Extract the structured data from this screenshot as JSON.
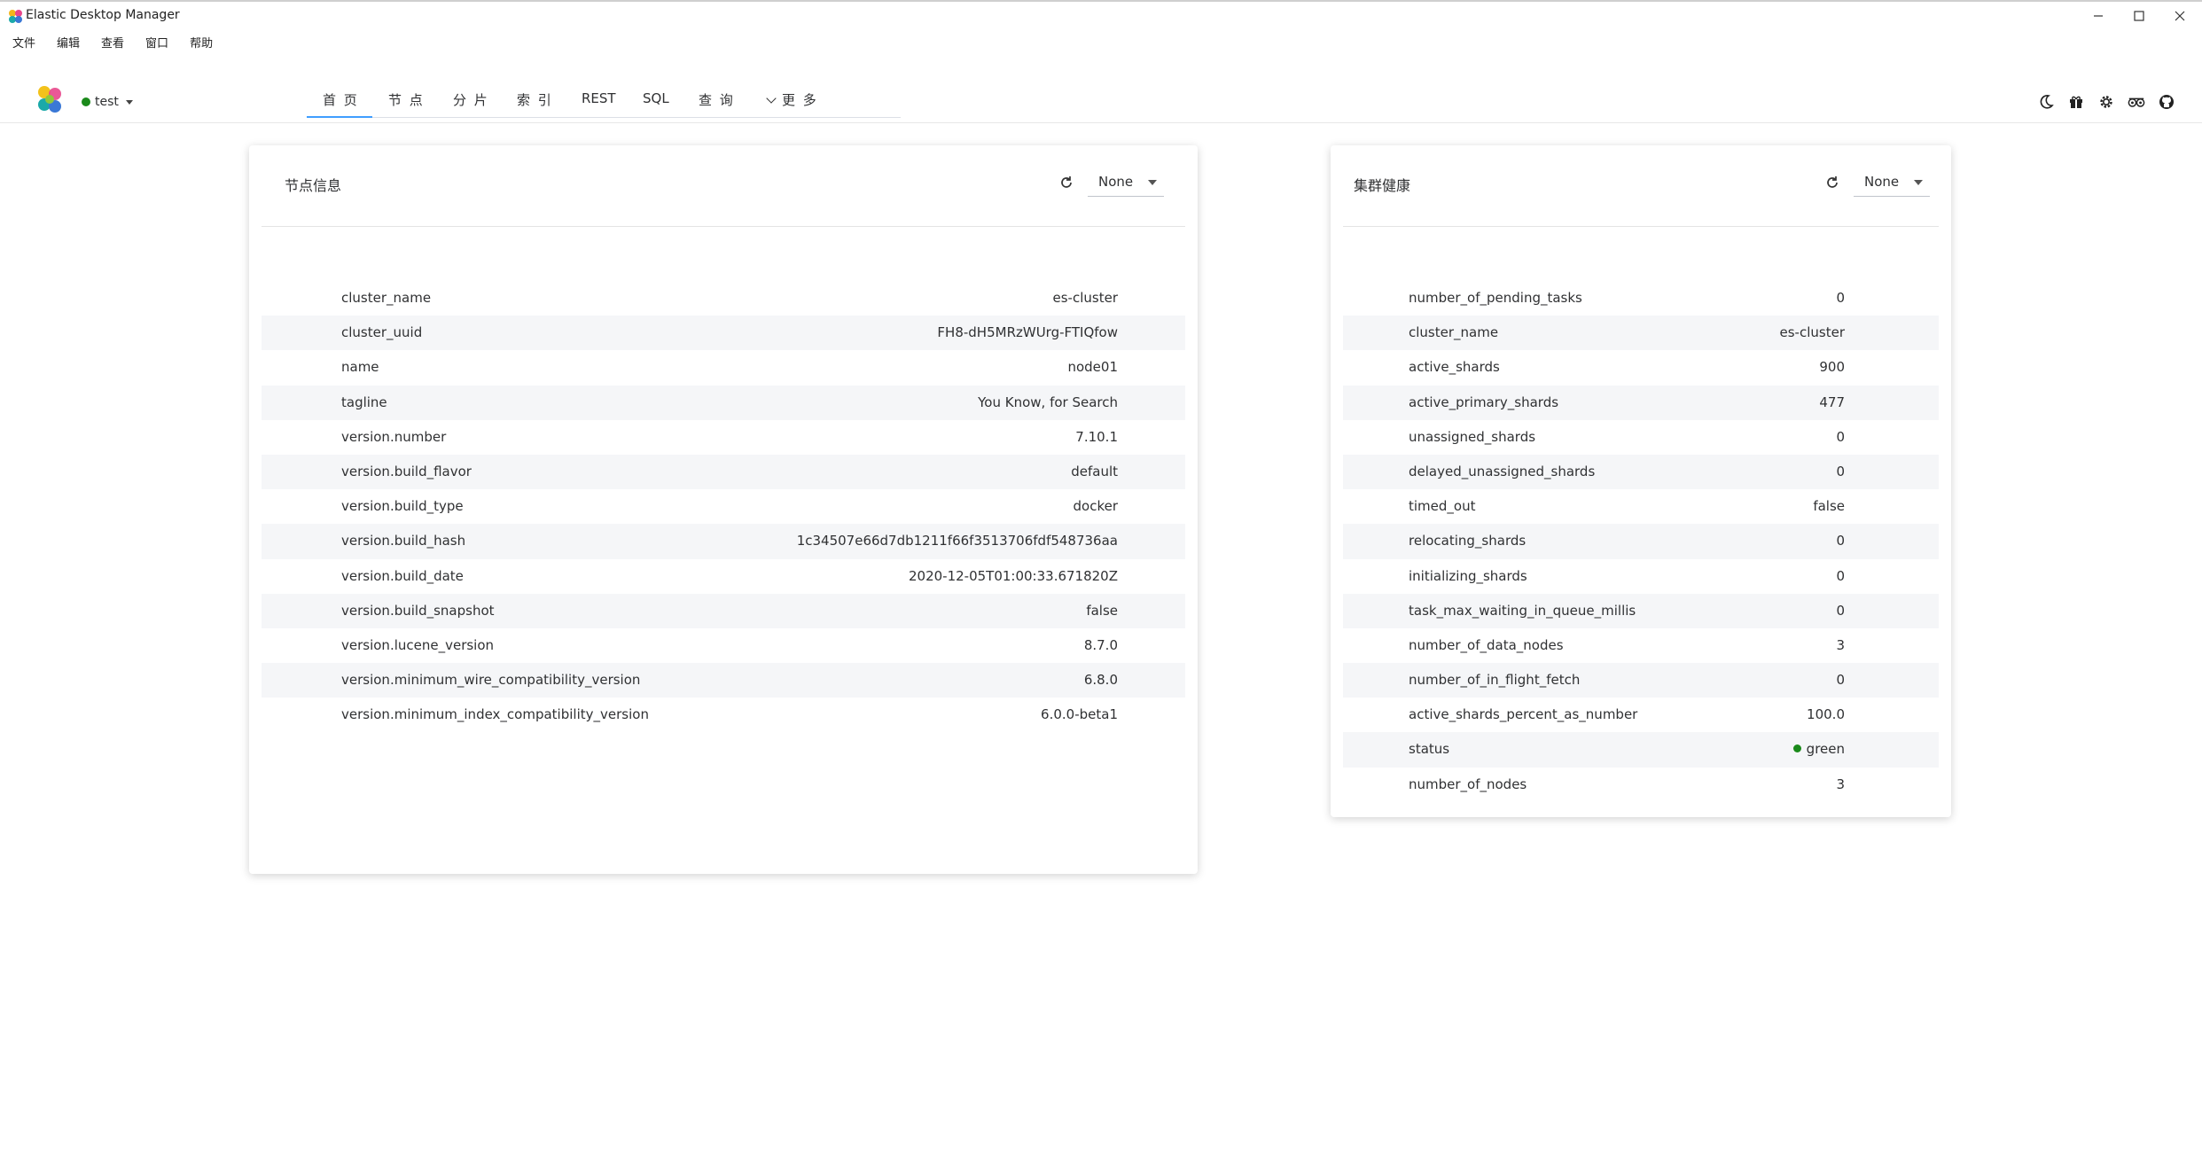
{
  "window": {
    "title": "Elastic Desktop Manager"
  },
  "menu": [
    "文件",
    "编辑",
    "查看",
    "窗口",
    "帮助"
  ],
  "header": {
    "cluster": "test",
    "tabs": [
      "首 页",
      "节 点",
      "分 片",
      "索 引",
      "REST",
      "SQL",
      "查 询",
      "更 多"
    ],
    "active_tab": "首 页",
    "tool_icons": [
      "moon-icon",
      "gift-icon",
      "gear-icon",
      "tripadvisor-icon",
      "github-icon"
    ]
  },
  "node_info": {
    "title": "节点信息",
    "select": "None",
    "rows": [
      {
        "k": "cluster_name",
        "v": "es-cluster"
      },
      {
        "k": "cluster_uuid",
        "v": "FH8-dH5MRzWUrg-FTIQfow"
      },
      {
        "k": "name",
        "v": "node01"
      },
      {
        "k": "tagline",
        "v": "You Know, for Search"
      },
      {
        "k": "version.number",
        "v": "7.10.1"
      },
      {
        "k": "version.build_flavor",
        "v": "default"
      },
      {
        "k": "version.build_type",
        "v": "docker"
      },
      {
        "k": "version.build_hash",
        "v": "1c34507e66d7db1211f66f3513706fdf548736aa"
      },
      {
        "k": "version.build_date",
        "v": "2020-12-05T01:00:33.671820Z"
      },
      {
        "k": "version.build_snapshot",
        "v": "false"
      },
      {
        "k": "version.lucene_version",
        "v": "8.7.0"
      },
      {
        "k": "version.minimum_wire_compatibility_version",
        "v": "6.8.0"
      },
      {
        "k": "version.minimum_index_compatibility_version",
        "v": "6.0.0-beta1"
      }
    ]
  },
  "cluster_health": {
    "title": "集群健康",
    "select": "None",
    "status_color": "#1b8a1b",
    "rows": [
      {
        "k": "number_of_pending_tasks",
        "v": "0"
      },
      {
        "k": "cluster_name",
        "v": "es-cluster"
      },
      {
        "k": "active_shards",
        "v": "900"
      },
      {
        "k": "active_primary_shards",
        "v": "477"
      },
      {
        "k": "unassigned_shards",
        "v": "0"
      },
      {
        "k": "delayed_unassigned_shards",
        "v": "0"
      },
      {
        "k": "timed_out",
        "v": "false"
      },
      {
        "k": "relocating_shards",
        "v": "0"
      },
      {
        "k": "initializing_shards",
        "v": "0"
      },
      {
        "k": "task_max_waiting_in_queue_millis",
        "v": "0"
      },
      {
        "k": "number_of_data_nodes",
        "v": "3"
      },
      {
        "k": "number_of_in_flight_fetch",
        "v": "0"
      },
      {
        "k": "active_shards_percent_as_number",
        "v": "100.0"
      },
      {
        "k": "status",
        "v": "green"
      },
      {
        "k": "number_of_nodes",
        "v": "3"
      }
    ]
  }
}
